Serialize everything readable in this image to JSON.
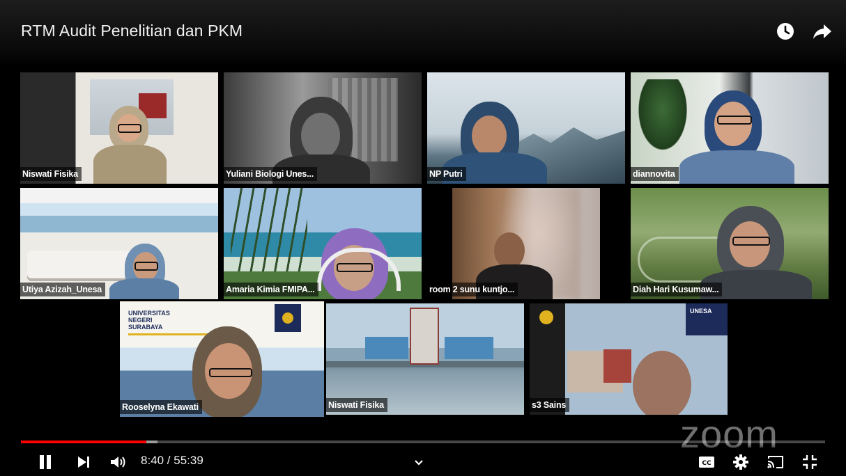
{
  "video": {
    "title": "RTM Audit Penelitian dan PKM",
    "current_time": "8:40",
    "duration": "55:39",
    "time_text": "8:40 / 55:39",
    "progress_fraction": 0.156,
    "buffered_fraction": 0.17
  },
  "icons": {
    "watch_later": "clock-icon",
    "share": "share-arrow-icon",
    "play_pause": "pause-icon",
    "next": "next-icon",
    "volume": "volume-icon",
    "expand": "chevron-down-icon",
    "captions": "cc-icon",
    "settings": "gear-icon",
    "cast": "cast-icon",
    "fullscreen_exit": "exit-fullscreen-icon"
  },
  "participants": [
    {
      "name": "Niswati Fisika"
    },
    {
      "name": "Yuliani Biologi Unes..."
    },
    {
      "name": "NP Putri"
    },
    {
      "name": "diannovita"
    },
    {
      "name": "Utiya Azizah_Unesa"
    },
    {
      "name": "Amaria Kimia FMIPA..."
    },
    {
      "name": "room 2 sunu kuntjo..."
    },
    {
      "name": "Diah Hari Kusumaw..."
    },
    {
      "name": "Rooselyna Ekawati",
      "active_speaker": true
    },
    {
      "name": "Niswati Fisika"
    },
    {
      "name": "s3 Sains"
    }
  ],
  "backgrounds": {
    "unesa_banner": [
      "UNIVERSITAS",
      "NEGERI",
      "SURABAYA"
    ],
    "unesa_logo_text": "UNESA"
  },
  "watermark": "zoom",
  "colors": {
    "progress_played": "#ff0000",
    "active_speaker_border": "#5bd24a"
  }
}
